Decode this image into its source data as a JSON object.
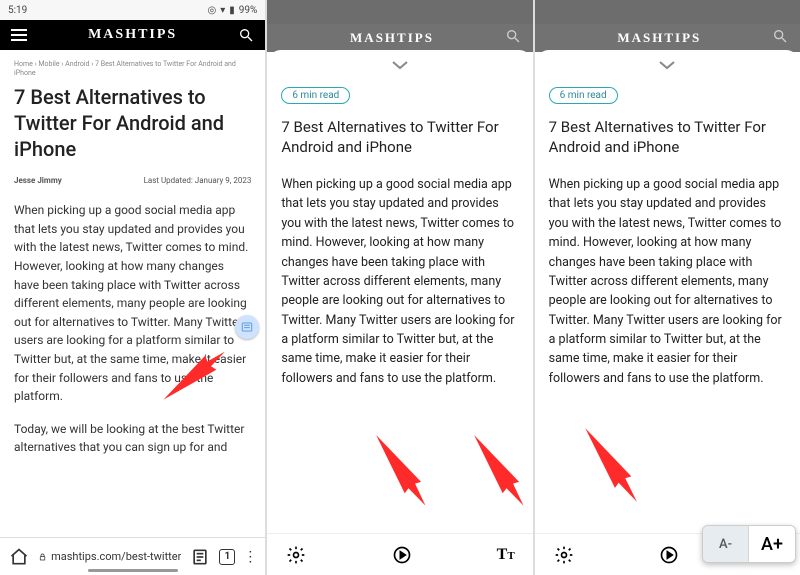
{
  "statusBar": {
    "time": "5:19",
    "battery": "99%"
  },
  "siteBrand": "MASHTIPS",
  "panel1": {
    "breadcrumb": "Home › Mobile › Android › 7 Best Alternatives to Twitter For Android and iPhone",
    "title": "7 Best Alternatives to Twitter For Android and iPhone",
    "author": "Jesse Jimmy",
    "updated": "Last Updated: January 9, 2023",
    "para1": "When picking up a good social media app that lets you stay updated and provides you with the latest news, Twitter comes to mind. However, looking at how many changes have been taking place with Twitter across different elements, many people are looking out for alternatives to Twitter. Many Twitter users are looking for a platform similar to Twitter but, at the same time, make it easier for their followers and fans to use the platform.",
    "para2": "Today, we will be looking at the best Twitter alternatives that you can sign up for and",
    "url": "mashtips.com/best-twitter",
    "tabCount": "1"
  },
  "readChip": "6 min read",
  "reader": {
    "title": "7 Best Alternatives to Twitter For Android and iPhone",
    "para": "When picking up a good social media app that lets you stay updated and provides you with the latest news, Twitter comes to mind. However, looking at how many changes have been taking place with Twitter across different elements, many people are looking out for alternatives to Twitter. Many Twitter users are looking for a platform similar to Twitter but, at the same time, make it easier for their followers and fans to use the platform."
  },
  "fontControls": {
    "minus": "A-",
    "plus": "A+"
  }
}
